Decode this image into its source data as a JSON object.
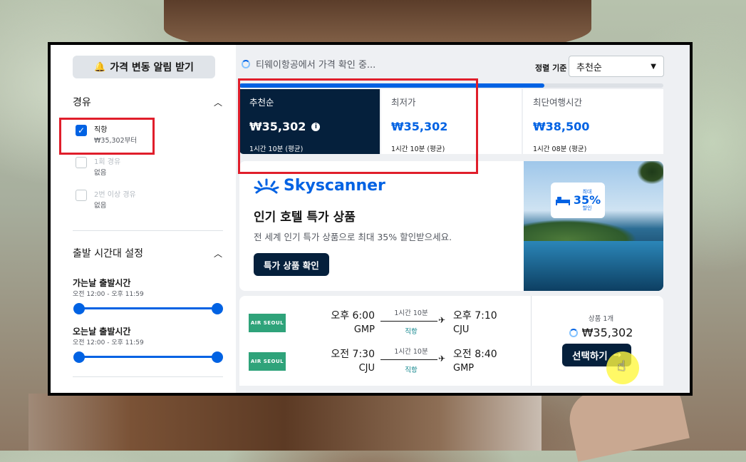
{
  "sidebar": {
    "alert_button": "가격 변동 알림 받기",
    "stops_title": "경유",
    "stops": [
      {
        "label": "직항",
        "sub": "₩35,302부터",
        "checked": true
      },
      {
        "label": "1회 경유",
        "sub": "없음",
        "checked": false
      },
      {
        "label": "2번 이상 경유",
        "sub": "없음",
        "checked": false
      }
    ],
    "times_title": "출발 시간대 설정",
    "outbound_title": "가는날 출발시간",
    "outbound_range": "오전 12:00 - 오후 11:59",
    "return_title": "오는날 출발시간",
    "return_range": "오전 12:00 - 오후 11:59"
  },
  "toolbar": {
    "status": "티웨이항공에서 가격 확인 중...",
    "sort_label": "정렬 기준",
    "sort_value": "추천순",
    "progress": 0.72
  },
  "tabs": [
    {
      "name": "추천순",
      "price": "₩35,302",
      "duration": "1시간 10분 (평균)"
    },
    {
      "name": "최저가",
      "price": "₩35,302",
      "duration": "1시간 10분 (평균)"
    },
    {
      "name": "최단여행시간",
      "price": "₩38,500",
      "duration": "1시간 08분 (평균)"
    }
  ],
  "ad": {
    "brand": "Skyscanner",
    "title": "인기 호텔 특가 상품",
    "description": "전 세계 인기 특가 상품으로 최대 35% 할인받으세요.",
    "button": "특가 상품 확인",
    "badge_top": "최대",
    "badge_value": "35%",
    "badge_bottom": "할인"
  },
  "flight": {
    "legs": [
      {
        "airline": "AIR SEOUL",
        "dep_time": "오후 6:00",
        "dep_airport": "GMP",
        "duration": "1시간 10분",
        "stops": "직항",
        "arr_time": "오후 7:10",
        "arr_airport": "CJU"
      },
      {
        "airline": "AIR SEOUL",
        "dep_time": "오전 7:30",
        "dep_airport": "CJU",
        "duration": "1시간 10분",
        "stops": "직항",
        "arr_time": "오전 8:40",
        "arr_airport": "GMP"
      }
    ],
    "deal_count": "상품 1개",
    "price": "₩35,302",
    "select_button": "선택하기"
  },
  "colors": {
    "accent": "#0062e3",
    "dark": "#05203c",
    "highlight": "#e01e2b",
    "airline": "#2fa37a"
  }
}
